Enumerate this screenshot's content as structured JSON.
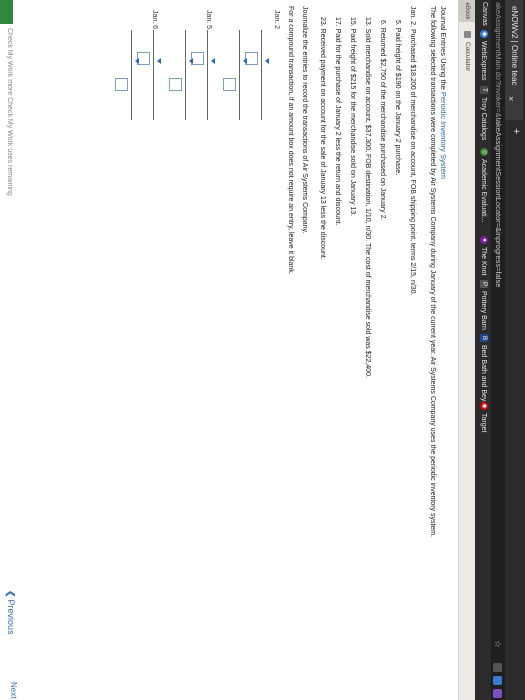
{
  "browser": {
    "tab_title": "eNOWv2 | Online teac",
    "tab_close": "×",
    "new_tab": "+",
    "url_prefix": "akeAssignmentMain.do?invoker=&",
    "url_rest": "takeAssignmentSessionLocator=&inprogress=false",
    "bookmarks": [
      {
        "label": "Canvas",
        "icon": "none"
      },
      {
        "label": "WebExpress",
        "icon": "web-icon",
        "color": "#3b7ddd"
      },
      {
        "label": "Troy Catalogs",
        "icon": "t-icon",
        "color": "#4a4a4a",
        "glyph": "T"
      },
      {
        "label": "Academic Evaluati...",
        "icon": "globe-icon",
        "color": "#2f7d32"
      },
      {
        "label": "The Knot",
        "icon": "knot-icon",
        "color": "#7a1fa2"
      },
      {
        "label": "Pottery Barn",
        "icon": "pb-icon",
        "color": "#555",
        "glyph": "PB"
      },
      {
        "label": "Bed Bath and Bey...",
        "icon": "bbb-icon",
        "color": "#23478f",
        "glyph": "B"
      },
      {
        "label": "Target",
        "icon": "target-icon",
        "color": "#cc0000"
      }
    ]
  },
  "toolbar": {
    "ebook_label": "eBook",
    "calculator_label": "Calculator"
  },
  "question": {
    "title_prefix": "Journal Entries Using the",
    "title_link": "Periodic Inventory System",
    "intro": "The following selected transactions were completed by Air Systems Company during January of the current year. Air Systems Company uses the periodic inventory system.",
    "transactions": [
      "Jan. 2.  Purchased $18,200 of merchandise on account, FOB shipping point, terms 2/15, n/30.",
      "5.  Paid freight of $190 on the January 2 purchase.",
      "6.  Returned $2,750 of the merchandise purchased on January 2.",
      "13.  Sold merchandise on account, $37,300, FOB destination, 1/10, n/30. The cost of merchandise sold was $22,400.",
      "15.  Paid freight of $215 for the merchandise sold on January 13.",
      "17.  Paid for the purchase of January 2 less the return and discount.",
      "23.  Received payment on account for the sale of January 13 less the discount."
    ],
    "instruction": "Journalize the entries to record the transactions of Air Systems Company.",
    "note": "For a compound transaction, if an amount box does not require an entry, leave it blank.",
    "journal_dates": [
      "Jan. 2",
      "Jan. 5",
      "Jan. 6"
    ]
  },
  "nav": {
    "previous_label": "Previous",
    "next_label": "Next"
  },
  "footer": {
    "text": "Check My Work   more Check My Work uses remaining"
  }
}
